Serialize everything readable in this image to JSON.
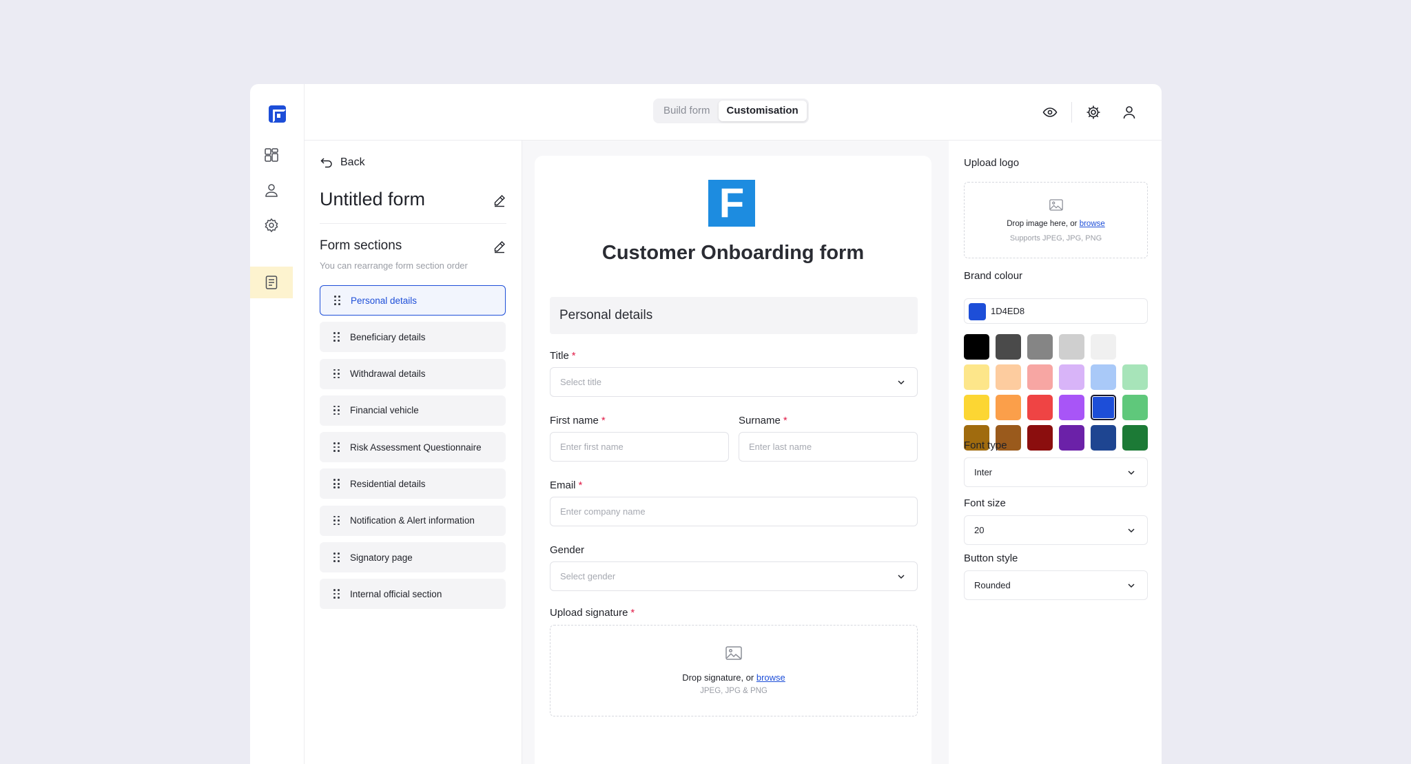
{
  "header": {
    "tabs": [
      {
        "label": "Build form",
        "active": false
      },
      {
        "label": "Customisation",
        "active": true
      }
    ],
    "icons": [
      "eye-icon",
      "gear-icon",
      "user-icon"
    ]
  },
  "rail": {
    "items": [
      "dashboard-icon",
      "user-icon",
      "settings-icon",
      "form-icon"
    ],
    "active_index": 3
  },
  "sections_panel": {
    "back_label": "Back",
    "form_title": "Untitled form",
    "heading": "Form sections",
    "subheading": "You can rearrange form section order",
    "items": [
      {
        "label": "Personal details",
        "active": true
      },
      {
        "label": "Beneficiary details",
        "active": false
      },
      {
        "label": "Withdrawal details",
        "active": false
      },
      {
        "label": "Financial vehicle",
        "active": false
      },
      {
        "label": "Risk Assessment Questionnaire",
        "active": false
      },
      {
        "label": "Residential details",
        "active": false
      },
      {
        "label": "Notification & Alert information",
        "active": false
      },
      {
        "label": "Signatory page",
        "active": false
      },
      {
        "label": "Internal official section",
        "active": false
      }
    ]
  },
  "preview": {
    "title": "Customer Onboarding form",
    "section_title": "Personal details",
    "fields": {
      "title": {
        "label": "Title",
        "required": "*",
        "placeholder": "Select title"
      },
      "first_name": {
        "label": "First name",
        "required": "*",
        "placeholder": "Enter first name"
      },
      "surname": {
        "label": "Surname",
        "required": "*",
        "placeholder": "Enter last name"
      },
      "email": {
        "label": "Email",
        "required": "*",
        "placeholder": "Enter company name"
      },
      "gender": {
        "label": "Gender",
        "placeholder": "Select gender"
      },
      "signature": {
        "label": "Upload signature",
        "required": "*",
        "drop_text": "Drop signature, or",
        "browse": "browse",
        "formats": "JPEG, JPG & PNG"
      }
    }
  },
  "customisation": {
    "upload_logo": {
      "label": "Upload logo",
      "drop_text": "Drop image here, or",
      "browse": "browse",
      "formats": "Supports JPEG, JPG, PNG"
    },
    "brand_colour": {
      "label": "Brand colour",
      "value": "1D4ED8",
      "swatch": "#1d4ed8"
    },
    "palette": [
      [
        "#000000",
        "#4a4a4a",
        "#858585",
        "#cfcfcf",
        "#f0f0f0"
      ],
      [
        "#fde68a",
        "#fdcc9f",
        "#f7a6a3",
        "#d8b4f8",
        "#a9c9f8",
        "#a7e4b9"
      ],
      [
        "#fcd633",
        "#fb9f4a",
        "#ef4444",
        "#a855f7",
        "#1d4ed8",
        "#5fc87b"
      ],
      [
        "#a06b0e",
        "#9a5a1c",
        "#8b0e0e",
        "#6b21a8",
        "#1e4591",
        "#1c7a36"
      ]
    ],
    "selected_swatch": "#1d4ed8",
    "font_type": {
      "label": "Font type",
      "value": "Inter"
    },
    "font_size": {
      "label": "Font size",
      "value": "20"
    },
    "button_style": {
      "label": "Button style",
      "value": "Rounded"
    }
  }
}
